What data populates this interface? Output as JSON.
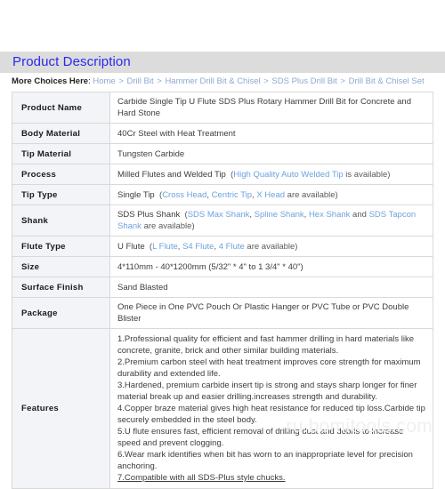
{
  "section": {
    "title": "Product Description"
  },
  "breadcrumb": {
    "label": "More Choices Here",
    "colon": ":",
    "separator": ">",
    "items": [
      {
        "label": "Home"
      },
      {
        "label": "Drill Bit"
      },
      {
        "label": "Hammer Drill Bit & Chisel"
      },
      {
        "label": "SDS Plus Drill Bit"
      },
      {
        "label": "Drill Bit & Chisel Set"
      }
    ]
  },
  "spec_table": {
    "rows": [
      {
        "key": "Product Name",
        "value_plain": "Carbide Single Tip U Flute SDS Plus Rotary Hammer Drill Bit for Concrete and Hard Stone"
      },
      {
        "key": "Body Material",
        "value_plain": "40Cr Steel with Heat Treatment"
      },
      {
        "key": "Tip Material",
        "value_plain": "Tungsten Carbide"
      },
      {
        "key": "Process",
        "value_main": "Milled Flutes and Welded Tip",
        "paren_open": "(",
        "links": [
          "High Quality Auto Welded Tip"
        ],
        "paren_tail": " is available)"
      },
      {
        "key": "Tip Type",
        "value_main": "Single Tip",
        "paren_open": "(",
        "links": [
          "Cross Head",
          "Centric Tip",
          "X Head"
        ],
        "paren_tail": " are available)"
      },
      {
        "key": "Shank",
        "value_main": "SDS Plus Shank",
        "paren_open": "(",
        "links": [
          "SDS Max Shank",
          "Spline Shank",
          "Hex Shank"
        ],
        "conjunction": "and",
        "link_last": "SDS Tapcon Shank",
        "paren_tail": " are available)"
      },
      {
        "key": "Flute Type",
        "value_main": "U Flute",
        "paren_open": "(",
        "links": [
          "L Flute",
          "S4 Flute",
          "4 Flute"
        ],
        "paren_tail": " are available)"
      },
      {
        "key": "Size",
        "value_plain": "4*110mm - 40*1200mm  (5/32\" * 4\" to 1 3/4\" * 40\")"
      },
      {
        "key": "Surface Finish",
        "value_plain": "Sand Blasted"
      },
      {
        "key": "Package",
        "value_plain": "One Piece in One PVC Pouch Or Plastic Hanger or PVC Tube or PVC Double Blister"
      }
    ],
    "features": {
      "key": "Features",
      "lines": [
        "1.Professional quality for efficient and fast hammer drilling in hard materials like concrete, granite, brick and other similar building materials.",
        "2.Premium carbon steel with heat treatment improves core strength for maximum durability and extended life.",
        "3.Hardened, premium carbide insert tip is strong and stays sharp longer for finer material break up and easier drilling.increases strength and durability.",
        "4.Copper braze material gives high heat resistance for reduced tip loss.Carbide tip securely embedded in the steel body.",
        "5.U flute ensures fast, efficient removal of drilling dust and debris to increase speed and prevent clogging.",
        "6.Wear mark identifies when bit has worn to an inappropriate level for precision anchoring.",
        "7.Compatible with all SDS-Plus style chucks."
      ],
      "underlined_index": 6
    }
  },
  "watermark": {
    "text": "ru.bomitools.com"
  },
  "colors": {
    "heading_text": "#2a2aee",
    "heading_band": "#dcdcdc",
    "link_blue": "#6ea2dd",
    "breadcrumb_link": "#8ca9cf",
    "key_cell_bg": "#f2f4f7",
    "border": "#d9d9d9",
    "watermark": "#f0f0f0"
  }
}
